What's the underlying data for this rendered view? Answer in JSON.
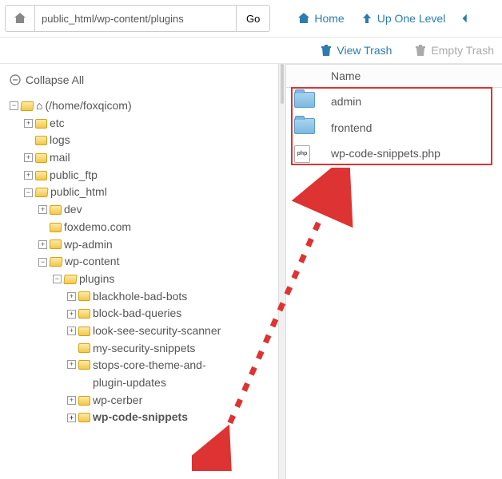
{
  "toolbar": {
    "path_value": "public_html/wp-content/plugins",
    "go_label": "Go",
    "home_label": "Home",
    "up_label": "Up One Level"
  },
  "trash": {
    "view_label": "View Trash",
    "empty_label": "Empty Trash"
  },
  "collapse_label": "Collapse All",
  "tree": {
    "root_label": "(/home/foxqicom)",
    "etc": "etc",
    "logs": "logs",
    "mail": "mail",
    "public_ftp": "public_ftp",
    "public_html": "public_html",
    "dev": "dev",
    "foxdemo": "foxdemo.com",
    "wp_admin": "wp-admin",
    "wp_content": "wp-content",
    "plugins": "plugins",
    "blackhole": "blackhole-bad-bots",
    "bbq": "block-bad-queries",
    "looksee": "look-see-security-scanner",
    "mysec": "my-security-snippets",
    "stops": "stops-core-theme-and-plugin-updates",
    "cerber": "wp-cerber",
    "snippets": "wp-code-snippets"
  },
  "table": {
    "name_header": "Name",
    "rows": [
      {
        "type": "folder",
        "name": "admin"
      },
      {
        "type": "folder",
        "name": "frontend"
      },
      {
        "type": "php",
        "name": "wp-code-snippets.php"
      }
    ]
  },
  "colors": {
    "link": "#2c7cb0",
    "disabled": "#aaa",
    "highlight_border": "#d33"
  }
}
